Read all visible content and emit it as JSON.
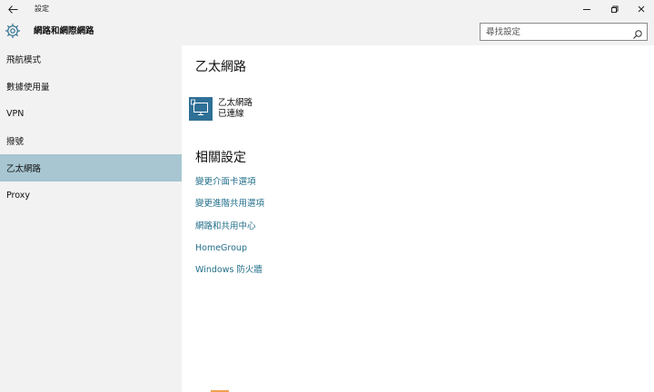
{
  "titlebar": {
    "back_icon": "back-arrow-icon",
    "title": "設定",
    "minimize_icon": "minimize-icon",
    "restore_icon": "restore-icon",
    "close_icon": "close-icon"
  },
  "header": {
    "gear_icon": "gear-icon",
    "title": "網路和網際網路",
    "search": {
      "placeholder": "尋找設定",
      "icon": "search-icon"
    }
  },
  "sidebar": {
    "items": [
      {
        "label": "飛航模式"
      },
      {
        "label": "數據使用量"
      },
      {
        "label": "VPN"
      },
      {
        "label": "撥號"
      },
      {
        "label": "乙太網路",
        "active": true
      },
      {
        "label": "Proxy"
      }
    ]
  },
  "main": {
    "title": "乙太網路",
    "ethernet": {
      "icon": "ethernet-monitor-icon",
      "name": "乙太網路",
      "status": "已連線"
    },
    "related_title": "相關設定",
    "links": [
      {
        "label": "變更介面卡選項"
      },
      {
        "label": "變更進階共用選項"
      },
      {
        "label": "網路和共用中心"
      },
      {
        "label": "HomeGroup"
      },
      {
        "label": "Windows 防火牆"
      }
    ]
  },
  "colors": {
    "accent_selected": "#a7c6d1",
    "link": "#236f8a",
    "tile_icon": "#2f7097",
    "chrome": "#f2f2f2"
  }
}
